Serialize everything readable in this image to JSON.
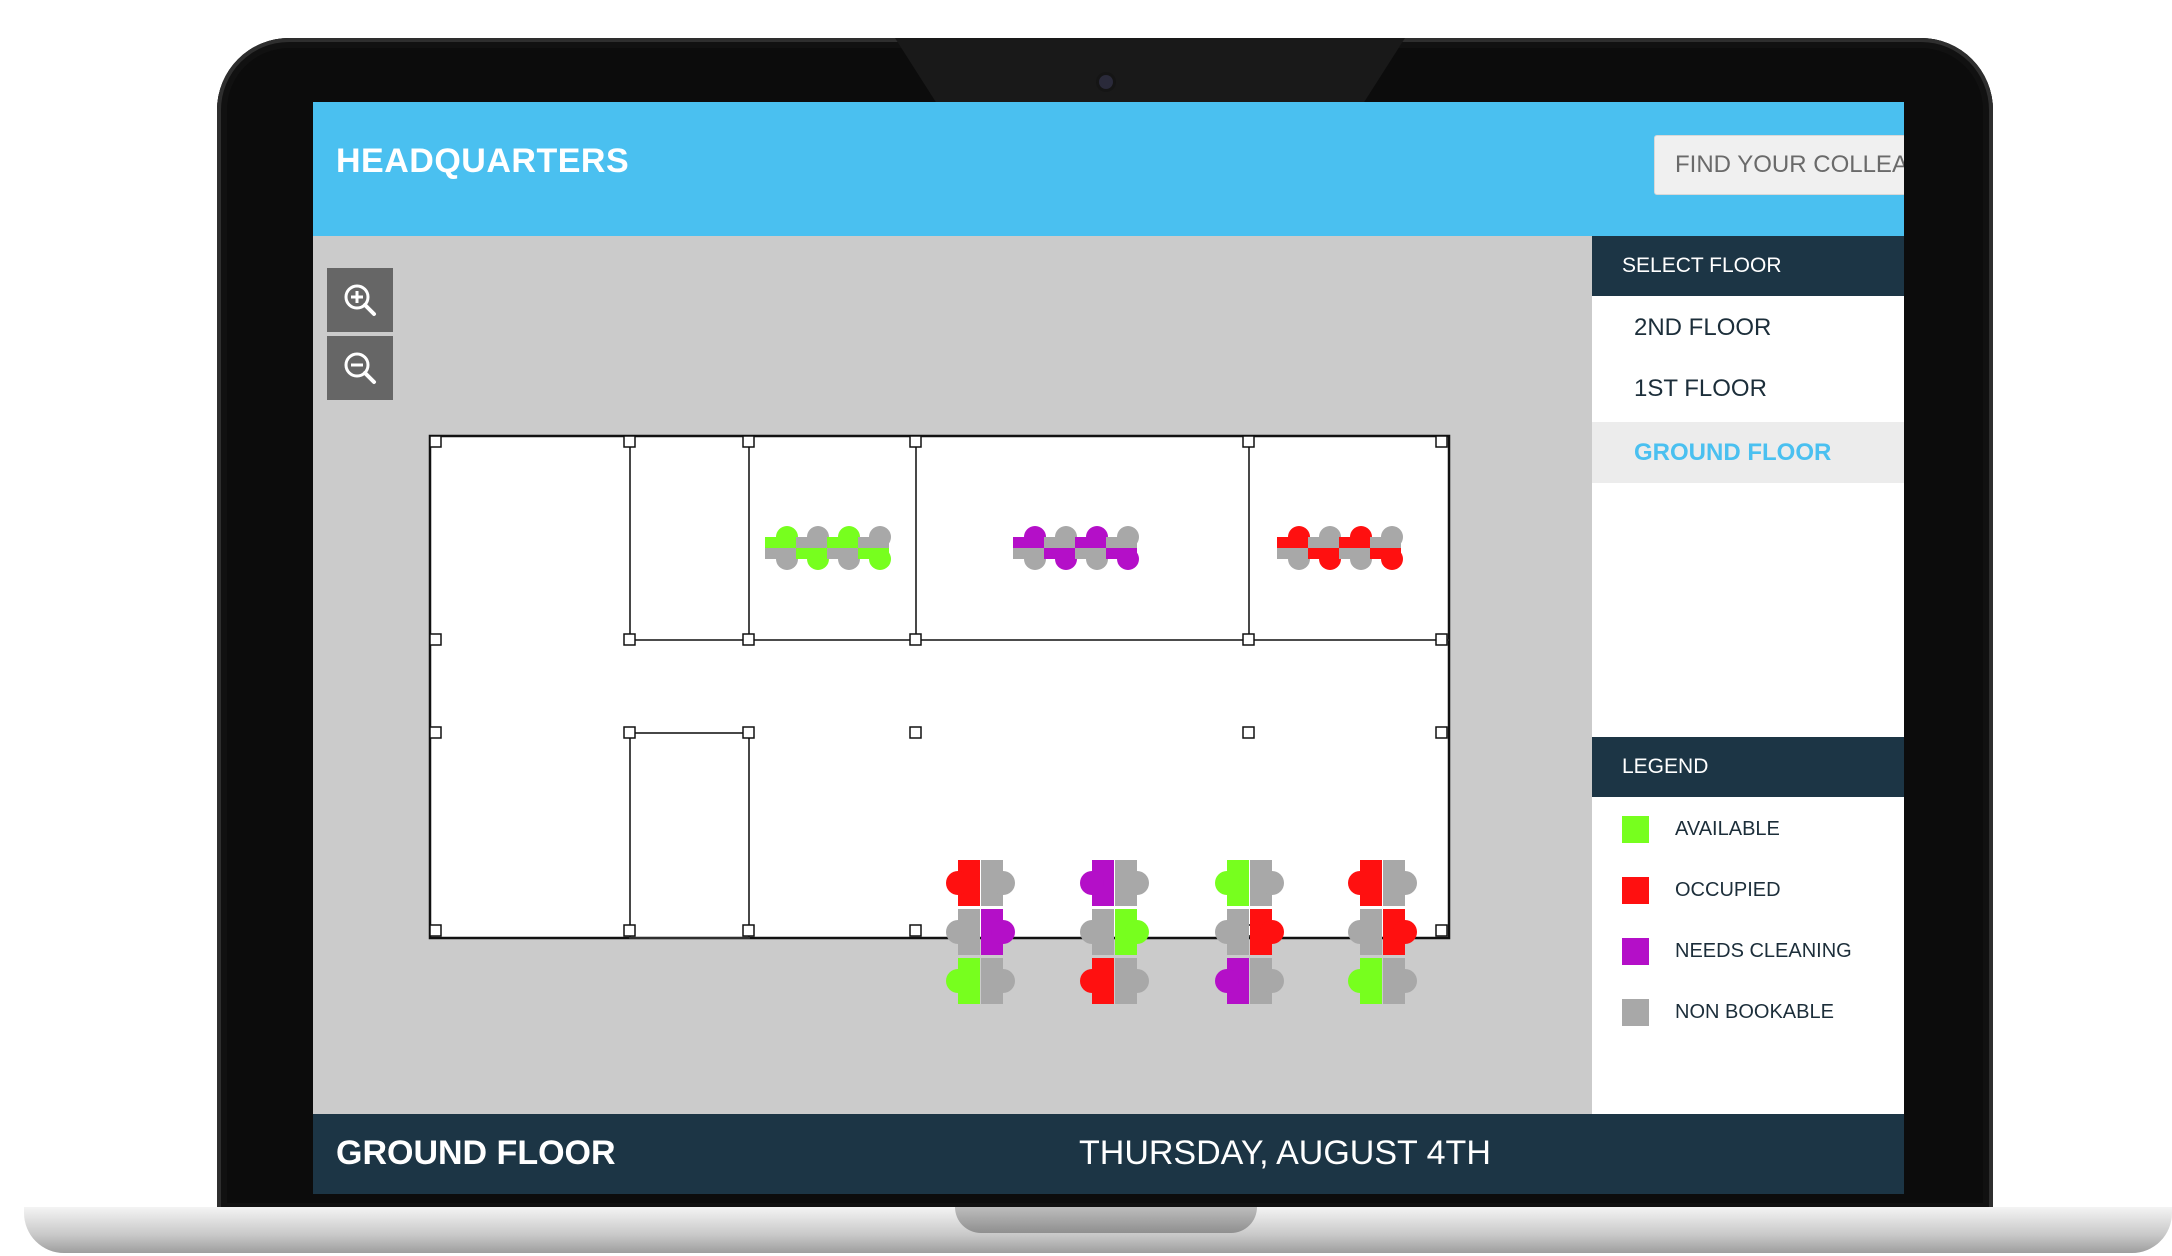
{
  "header": {
    "title": "HEADQUARTERS",
    "search_placeholder": "FIND YOUR COLLEAGUE"
  },
  "zoom": {
    "in_icon": "zoom-in-icon",
    "out_icon": "zoom-out-icon"
  },
  "sidebar": {
    "floor_heading": "SELECT FLOOR",
    "floors": [
      {
        "label": "2ND FLOOR",
        "selected": false
      },
      {
        "label": "1ST FLOOR",
        "selected": false
      },
      {
        "label": "GROUND FLOOR",
        "selected": true
      }
    ],
    "legend_heading": "LEGEND",
    "legend": [
      {
        "label": "AVAILABLE",
        "color": "#77ff1e"
      },
      {
        "label": "OCCUPIED",
        "color": "#ff1010"
      },
      {
        "label": "NEEDS CLEANING",
        "color": "#b40fc8"
      },
      {
        "label": "NON BOOKABLE",
        "color": "#a8a8a8"
      }
    ]
  },
  "floorplan": {
    "seat_colors": {
      "available": "#77ff1e",
      "occupied": "#ff1010",
      "cleaning": "#b40fc8",
      "non_bookable": "#a8a8a8"
    },
    "horizontal_clusters": [
      {
        "top": [
          "available",
          "non_bookable",
          "available",
          "non_bookable"
        ],
        "bottom": [
          "non_bookable",
          "available",
          "non_bookable",
          "available"
        ]
      },
      {
        "top": [
          "cleaning",
          "non_bookable",
          "cleaning",
          "non_bookable"
        ],
        "bottom": [
          "non_bookable",
          "cleaning",
          "non_bookable",
          "cleaning"
        ]
      },
      {
        "top": [
          "occupied",
          "non_bookable",
          "occupied",
          "non_bookable"
        ],
        "bottom": [
          "non_bookable",
          "occupied",
          "non_bookable",
          "occupied"
        ]
      }
    ],
    "vertical_clusters": [
      {
        "left": [
          "occupied",
          "non_bookable",
          "available"
        ],
        "right": [
          "non_bookable",
          "cleaning",
          "non_bookable"
        ]
      },
      {
        "left": [
          "cleaning",
          "non_bookable",
          "occupied"
        ],
        "right": [
          "non_bookable",
          "available",
          "non_bookable"
        ]
      },
      {
        "left": [
          "available",
          "non_bookable",
          "cleaning"
        ],
        "right": [
          "non_bookable",
          "occupied",
          "non_bookable"
        ]
      },
      {
        "left": [
          "occupied",
          "non_bookable",
          "available"
        ],
        "right": [
          "non_bookable",
          "occupied",
          "non_bookable"
        ]
      }
    ]
  },
  "footer": {
    "floor": "GROUND FLOOR",
    "date": "THURSDAY, AUGUST 4TH"
  }
}
